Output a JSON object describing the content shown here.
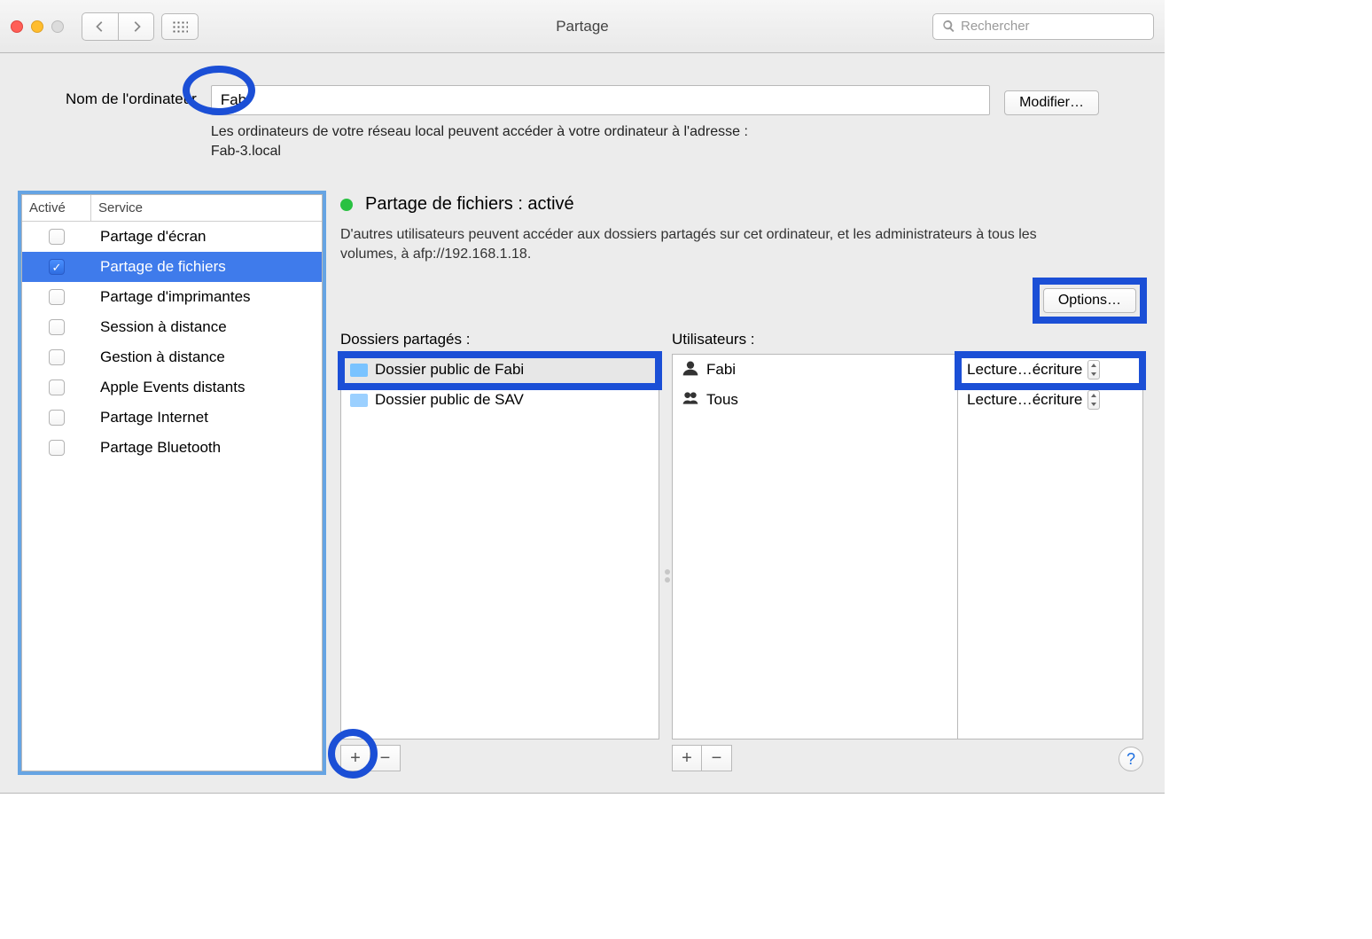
{
  "toolbar": {
    "title": "Partage",
    "search_placeholder": "Rechercher"
  },
  "computer_name": {
    "label": "Nom de l'ordinateur",
    "value": "Fab",
    "desc_line1": "Les ordinateurs de votre réseau local peuvent accéder à votre ordinateur à l'adresse :",
    "desc_line2": "Fab-3.local",
    "modify_label": "Modifier…"
  },
  "services": {
    "col_active": "Activé",
    "col_service": "Service",
    "items": [
      {
        "label": "Partage d'écran",
        "checked": false,
        "selected": false
      },
      {
        "label": "Partage de fichiers",
        "checked": true,
        "selected": true
      },
      {
        "label": "Partage d'imprimantes",
        "checked": false,
        "selected": false
      },
      {
        "label": "Session à distance",
        "checked": false,
        "selected": false
      },
      {
        "label": "Gestion à distance",
        "checked": false,
        "selected": false
      },
      {
        "label": "Apple Events distants",
        "checked": false,
        "selected": false
      },
      {
        "label": "Partage Internet",
        "checked": false,
        "selected": false
      },
      {
        "label": "Partage Bluetooth",
        "checked": false,
        "selected": false
      }
    ]
  },
  "file_sharing": {
    "status_title": "Partage de fichiers : activé",
    "status_desc": "D'autres utilisateurs peuvent accéder aux dossiers partagés sur cet ordinateur, et les administrateurs à tous les volumes, à afp://192.168.1.18.",
    "options_label": "Options…",
    "shared_folders_title": "Dossiers partagés :",
    "users_title": "Utilisateurs :",
    "folders": [
      {
        "label": "Dossier public de Fabi",
        "selected": true
      },
      {
        "label": "Dossier public de SAV",
        "selected": false
      }
    ],
    "users": [
      {
        "label": "Fabi",
        "kind": "person",
        "perm": "Lecture…écriture"
      },
      {
        "label": "Tous",
        "kind": "group",
        "perm": "Lecture…écriture"
      }
    ]
  },
  "help_label": "?"
}
